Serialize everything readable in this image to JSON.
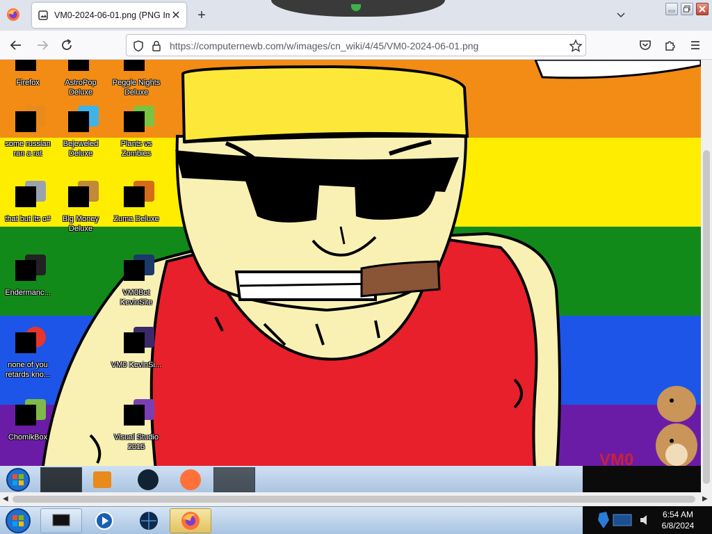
{
  "browser": {
    "tab_title": "VM0-2024-06-01.png (PNG Ima",
    "url": "https://computernewb.com/w/images/cn_wiki/4/45/VM0-2024-06-01.png",
    "icons": {
      "back": "back-arrow-icon",
      "forward": "forward-arrow-icon",
      "reload": "reload-icon",
      "bookmark": "star-icon",
      "pocket": "pocket-icon",
      "extensions": "puzzle-icon",
      "menu": "hamburger-menu-icon"
    }
  },
  "image": {
    "desktop_icons": [
      {
        "label": "Firefox"
      },
      {
        "label": "AstroPop Deluxe"
      },
      {
        "label": "Peggle Nights Deluxe"
      },
      {
        "label": "some russian ran a rat"
      },
      {
        "label": "Bejeweled Deluxe"
      },
      {
        "label": "Plants vs Zombies"
      },
      {
        "label": "that but its c#"
      },
      {
        "label": "Big Money Deluxe"
      },
      {
        "label": "Zuma Deluxe"
      },
      {
        "label": "Endermanc..."
      },
      {
        "label": "VM0Bot KevinSite"
      },
      {
        "label": "none of you retards kno..."
      },
      {
        "label": "VM0 KevinSi..."
      },
      {
        "label": "ChomikBox"
      },
      {
        "label": "Visual Studio 2015"
      }
    ],
    "watermark": "VM0",
    "rainbow_colors": [
      "#f28c14",
      "#ffed00",
      "#128a1a",
      "#1c55e8",
      "#6b1ca6"
    ]
  },
  "taskbar": {
    "clock_time": "6:54 AM",
    "clock_date": "6/8/2024"
  }
}
